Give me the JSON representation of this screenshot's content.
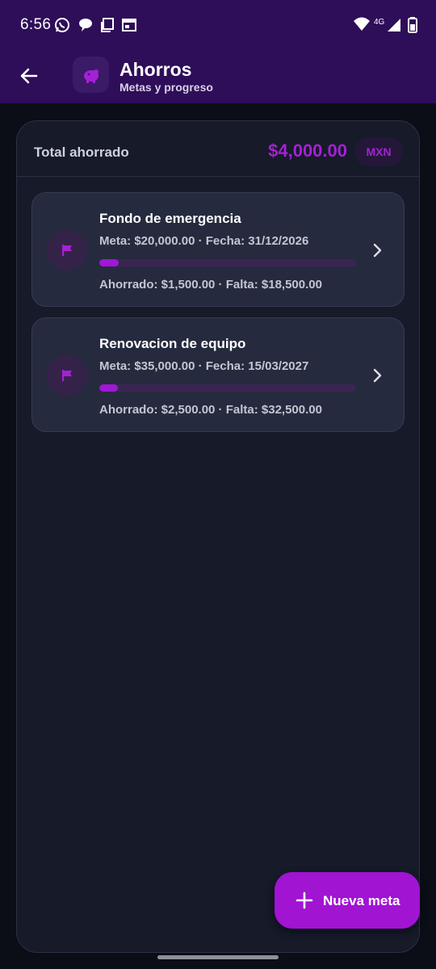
{
  "status_bar": {
    "time": "6:56",
    "network": "4G",
    "icons": [
      "whatsapp-icon",
      "chat-bubble-icon",
      "copy-icon",
      "calendar-app-icon",
      "wifi-icon",
      "signal-icon",
      "battery-icon"
    ]
  },
  "app_bar": {
    "title": "Ahorros",
    "subtitle": "Metas y progreso",
    "icon": "piggy-bank-icon"
  },
  "summary": {
    "label": "Total ahorrado",
    "amount": "$4,000.00",
    "currency": "MXN"
  },
  "goals": [
    {
      "name": "Fondo de emergencia",
      "meta_line": "Meta: $20,000.00 · Fecha: 31/12/2026",
      "saved_line": "Ahorrado: $1,500.00 · Falta: $18,500.00",
      "progress": 0.075,
      "icon": "flag-icon"
    },
    {
      "name": "Renovacion de equipo",
      "meta_line": "Meta: $35,000.00 · Fecha: 15/03/2027",
      "saved_line": "Ahorrado: $2,500.00 · Falta: $32,500.00",
      "progress": 0.0714,
      "icon": "flag-icon"
    }
  ],
  "fab": {
    "label": "Nueva meta",
    "icon": "plus-icon"
  },
  "colors": {
    "accent": "#a014d2",
    "header": "#2e0d59",
    "background": "#0b0d17",
    "card": "#262a3e"
  }
}
